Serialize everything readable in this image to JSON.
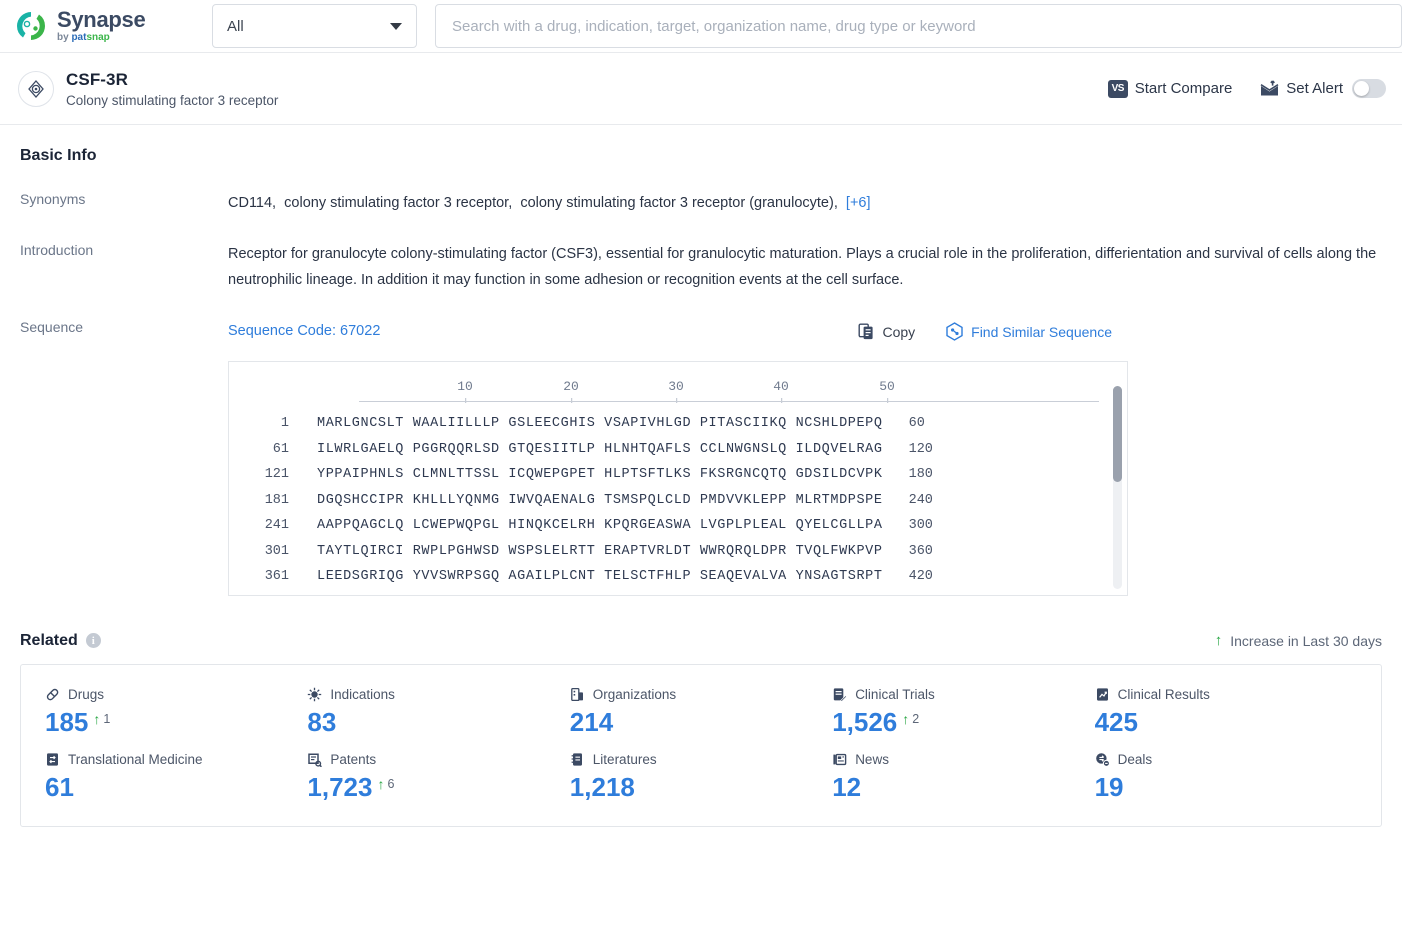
{
  "topbar": {
    "logo_title": "Synapse",
    "logo_sub_by": "by ",
    "logo_sub_pat": "pat",
    "logo_sub_snap": "snap",
    "scope_value": "All",
    "search_placeholder": "Search with a drug, indication, target, organization name, drug type or keyword",
    "search_value": ""
  },
  "entity": {
    "title": "CSF-3R",
    "subtitle": "Colony stimulating factor 3 receptor",
    "compare_label": "Start Compare",
    "compare_badge": "VS",
    "alert_label": "Set Alert",
    "alert_on": false
  },
  "basic_info": {
    "section_title": "Basic Info",
    "synonyms_label": "Synonyms",
    "synonyms": [
      "CD114,",
      "colony stimulating factor 3 receptor,",
      "colony stimulating factor 3 receptor (granulocyte),"
    ],
    "synonyms_more": "[+6]",
    "introduction_label": "Introduction",
    "introduction": "Receptor for granulocyte colony-stimulating factor (CSF3), essential for granulocytic maturation. Plays a crucial role in the proliferation, differientation and survival of cells along the neutrophilic lineage. In addition it may function in some adhesion or recognition events at the cell surface.",
    "sequence_label": "Sequence",
    "sequence_code": "Sequence Code: 67022",
    "copy_label": "Copy",
    "find_similar_label": "Find Similar Sequence"
  },
  "sequence_viewer": {
    "ruler_ticks": [
      10,
      20,
      30,
      40,
      50
    ],
    "rows": [
      {
        "start": "1",
        "chunks": "MARLGNCSLT WAALIILLLP GSLEECGHIS VSAPIVHLGD PITASCIIKQ NCSHLDPEPQ",
        "end": "60"
      },
      {
        "start": "61",
        "chunks": "ILWRLGAELQ PGGRQQRLSD GTQESIITLP HLNHTQAFLS CCLNWGNSLQ ILDQVELRAG",
        "end": "120"
      },
      {
        "start": "121",
        "chunks": "YPPAIPHNLS CLMNLTTSSL ICQWEPGPET HLPTSFTLKS FKSRGNCQTQ GDSILDCVPK",
        "end": "180"
      },
      {
        "start": "181",
        "chunks": "DGQSHCCIPR KHLLLYQNMG IWVQAENALG TSMSPQLCLD PMDVVKLEPP MLRTMDPSPE",
        "end": "240"
      },
      {
        "start": "241",
        "chunks": "AAPPQAGCLQ LCWEPWQPGL HINQKCELRH KPQRGEASWA LVGPLPLEAL QYELCGLLPA",
        "end": "300"
      },
      {
        "start": "301",
        "chunks": "TAYTLQIRCI RWPLPGHWSD WSPSLELRTT ERAPTVRLDT WWRQRQLDPR TVQLFWKPVP",
        "end": "360"
      },
      {
        "start": "361",
        "chunks": "LEEDSGRIQG YVVSWRPSGQ AGAILPLCNT TELSCTFHLP SEAQEVALVA YNSAGTSRPT",
        "end": "420"
      }
    ]
  },
  "related": {
    "title": "Related",
    "info_glyph": "i",
    "legend": "Increase in Last 30 days",
    "arrow_glyph": "↑",
    "stats": [
      {
        "label": "Drugs",
        "icon": "capsule-icon",
        "value": "185",
        "delta": "1"
      },
      {
        "label": "Indications",
        "icon": "virus-icon",
        "value": "83",
        "delta": ""
      },
      {
        "label": "Organizations",
        "icon": "building-icon",
        "value": "214",
        "delta": ""
      },
      {
        "label": "Clinical Trials",
        "icon": "clipboard-edit-icon",
        "value": "1,526",
        "delta": "2"
      },
      {
        "label": "Clinical Results",
        "icon": "chart-doc-icon",
        "value": "425",
        "delta": ""
      },
      {
        "label": "Translational Medicine",
        "icon": "transfer-doc-icon",
        "value": "61",
        "delta": ""
      },
      {
        "label": "Patents",
        "icon": "patent-icon",
        "value": "1,723",
        "delta": "6"
      },
      {
        "label": "Literatures",
        "icon": "book-icon",
        "value": "1,218",
        "delta": ""
      },
      {
        "label": "News",
        "icon": "news-icon",
        "value": "12",
        "delta": ""
      },
      {
        "label": "Deals",
        "icon": "deal-icon",
        "value": "19",
        "delta": ""
      }
    ]
  },
  "colors": {
    "accent_blue": "#2f7ddb",
    "green": "#2aa745",
    "dark_navy": "#3c4a63",
    "label_gray": "#6b7689"
  }
}
